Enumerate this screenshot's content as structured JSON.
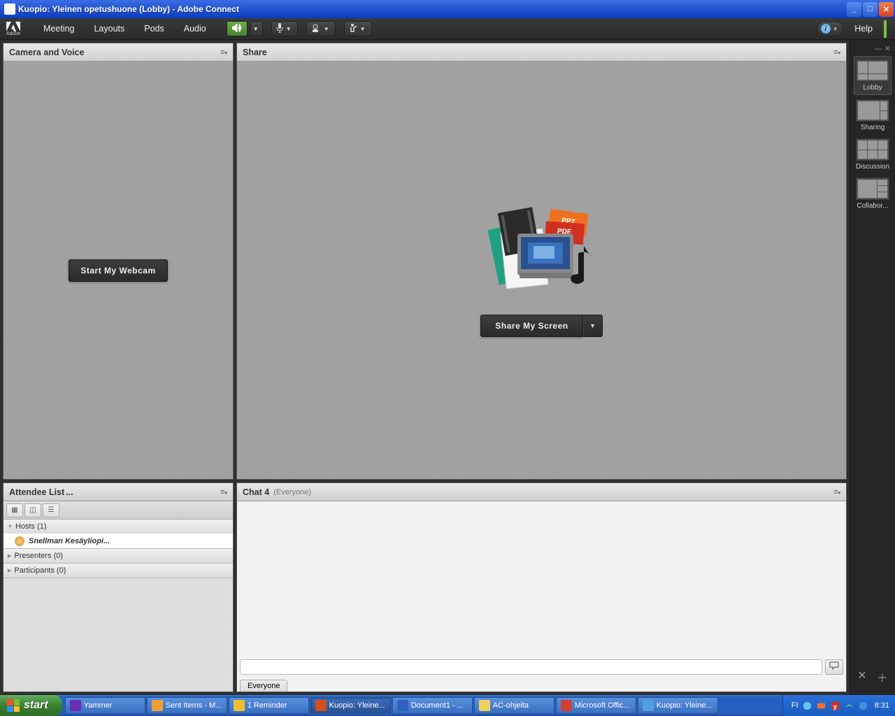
{
  "window": {
    "title": "Kuopio: Yleinen opetushuone (Lobby) - Adobe Connect"
  },
  "menubar": {
    "brand_label": "Adobe",
    "items": [
      "Meeting",
      "Layouts",
      "Pods",
      "Audio"
    ],
    "help": "Help"
  },
  "right_rail": {
    "layouts": [
      {
        "label": "Lobby",
        "active": true
      },
      {
        "label": "Sharing",
        "active": false
      },
      {
        "label": "Discussion",
        "active": false
      },
      {
        "label": "Collabor...",
        "active": false
      }
    ]
  },
  "pods": {
    "camera": {
      "title": "Camera and Voice",
      "button": "Start My Webcam"
    },
    "share": {
      "title": "Share",
      "button": "Share My Screen"
    },
    "attendee": {
      "title": "Attendee List",
      "title_suffix": "...",
      "sections": {
        "hosts": {
          "label": "Hosts (1)",
          "items": [
            "Snellman Kesäyliopi..."
          ]
        },
        "presenters": {
          "label": "Presenters (0)"
        },
        "participants": {
          "label": "Participants (0)"
        }
      }
    },
    "chat": {
      "title": "Chat 4",
      "scope": "(Everyone)",
      "tab": "Everyone"
    }
  },
  "taskbar": {
    "start": "start",
    "items": [
      {
        "label": "Yammer",
        "color": "#6b2fb3"
      },
      {
        "label": "Sent Items - M...",
        "color": "#f0a030"
      },
      {
        "label": "1 Reminder",
        "color": "#f0c030"
      },
      {
        "label": "Kuopio: Yleine...",
        "color": "#d05020",
        "active": true
      },
      {
        "label": "Document1 - ...",
        "color": "#3060c0"
      },
      {
        "label": "AC-ohjeita",
        "color": "#f0d060"
      },
      {
        "label": "Microsoft Offic...",
        "color": "#d04030"
      },
      {
        "label": "Kuopio: Yleine...",
        "color": "#50a0e0"
      }
    ],
    "lang": "FI",
    "clock": "8:31"
  }
}
